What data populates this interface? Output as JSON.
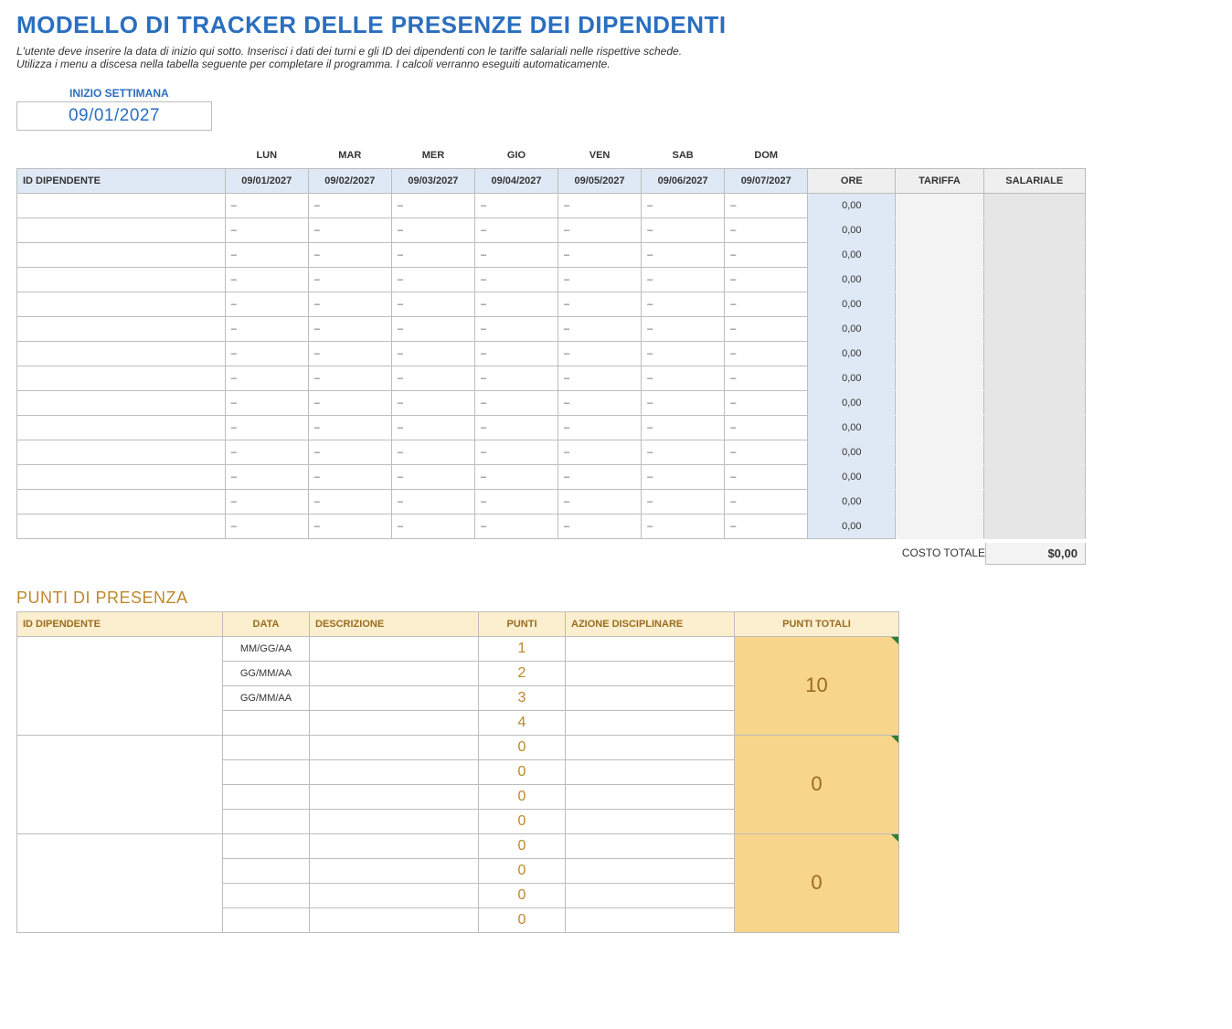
{
  "header": {
    "title": "MODELLO DI TRACKER DELLE PRESENZE DEI DIPENDENTI",
    "instructions_line1": "L'utente deve inserire la data di inizio qui sotto.  Inserisci i dati dei turni e gli ID dei dipendenti con le tariffe salariali nelle rispettive schede.",
    "instructions_line2": "Utilizza i menu a discesa nella tabella seguente per completare il programma. I calcoli verranno eseguiti automaticamente."
  },
  "week_start": {
    "label": "INIZIO SETTIMANA",
    "value": "09/01/2027"
  },
  "schedule": {
    "day_labels": [
      "LUN",
      "MAR",
      "MER",
      "GIO",
      "VEN",
      "SAB",
      "DOM"
    ],
    "dates": [
      "09/01/2027",
      "09/02/2027",
      "09/03/2027",
      "09/04/2027",
      "09/05/2027",
      "09/06/2027",
      "09/07/2027"
    ],
    "col_id": "ID DIPENDENTE",
    "col_ore": "ORE",
    "col_tariffa": "TARIFFA",
    "col_salariale": "SALARIALE",
    "placeholder": "–",
    "ore_value": "0,00",
    "row_count": 14,
    "cost_label": "COSTO TOTALE",
    "cost_value": "$0,00"
  },
  "points_section": {
    "title": "PUNTI DI PRESENZA",
    "col_id": "ID DIPENDENTE",
    "col_data": "DATA",
    "col_desc": "DESCRIZIONE",
    "col_punti": "PUNTI",
    "col_azione": "AZIONE DISCIPLINARE",
    "col_tot": "PUNTI TOTALI",
    "groups": [
      {
        "total": "10",
        "rows": [
          {
            "data": "MM/GG/AA",
            "desc": "",
            "punti": "1",
            "azione": ""
          },
          {
            "data": "GG/MM/AA",
            "desc": "",
            "punti": "2",
            "azione": ""
          },
          {
            "data": "GG/MM/AA",
            "desc": "",
            "punti": "3",
            "azione": ""
          },
          {
            "data": "",
            "desc": "",
            "punti": "4",
            "azione": ""
          }
        ]
      },
      {
        "total": "0",
        "rows": [
          {
            "data": "",
            "desc": "",
            "punti": "0",
            "azione": ""
          },
          {
            "data": "",
            "desc": "",
            "punti": "0",
            "azione": ""
          },
          {
            "data": "",
            "desc": "",
            "punti": "0",
            "azione": ""
          },
          {
            "data": "",
            "desc": "",
            "punti": "0",
            "azione": ""
          }
        ]
      },
      {
        "total": "0",
        "rows": [
          {
            "data": "",
            "desc": "",
            "punti": "0",
            "azione": ""
          },
          {
            "data": "",
            "desc": "",
            "punti": "0",
            "azione": ""
          },
          {
            "data": "",
            "desc": "",
            "punti": "0",
            "azione": ""
          },
          {
            "data": "",
            "desc": "",
            "punti": "0",
            "azione": ""
          }
        ]
      }
    ]
  }
}
